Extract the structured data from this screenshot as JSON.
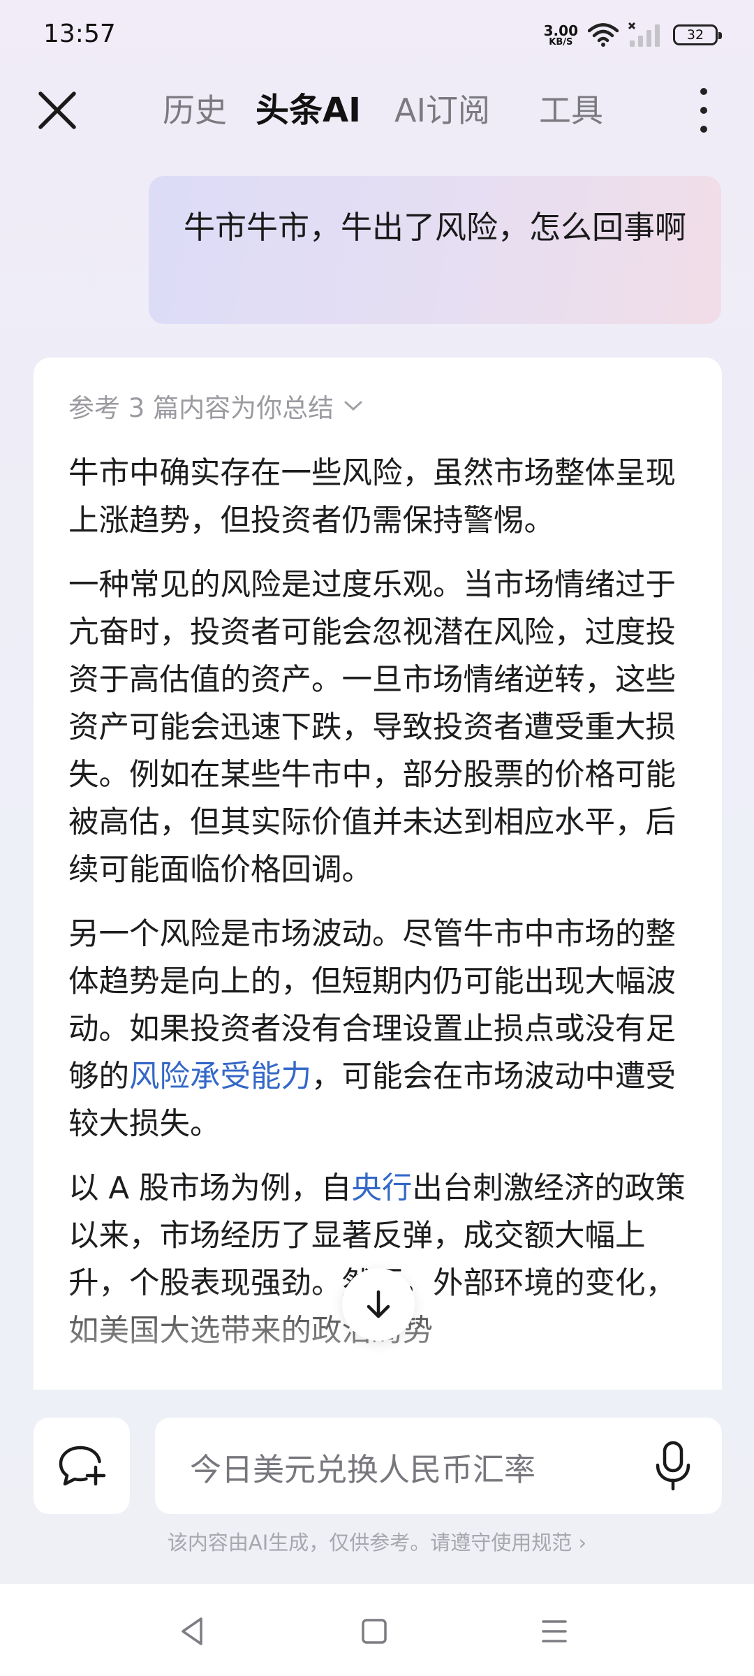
{
  "status_bar": {
    "time": "13:57",
    "net_speed_value": "3.00",
    "net_speed_unit": "KB/S",
    "battery": "32",
    "icons": [
      "wifi-icon",
      "signal-icon",
      "battery-icon"
    ]
  },
  "nav": {
    "tabs": [
      {
        "label": "历史",
        "active": false
      },
      {
        "label": "头条AI",
        "active": true
      },
      {
        "label": "AI订阅",
        "active": false
      },
      {
        "label": "工具",
        "active": false
      }
    ]
  },
  "user_message": "牛市牛市，牛出了风险，怎么回事啊",
  "answer": {
    "ref_summary": "参考 3 篇内容为你总结",
    "p1": "牛市中确实存在一些风险，虽然市场整体呈现上涨趋势，但投资者仍需保持警惕。",
    "p2": "一种常见的风险是过度乐观。当市场情绪过于亢奋时，投资者可能会忽视潜在风险，过度投资于高估值的资产。一旦市场情绪逆转，这些资产可能会迅速下跌，导致投资者遭受重大损失。例如在某些牛市中，部分股票的价格可能被高估，但其实际价值并未达到相应水平，后续可能面临价格回调。",
    "p3_before": "另一个风险是市场波动。尽管牛市中市场的整体趋势是向上的，但短期内仍可能出现大幅波动。如果投资者没有合理设置止损点或没有足够的",
    "p3_link": "风险承受能力",
    "p3_after": "，可能会在市场波动中遭受较大损失。",
    "p4_before": "以 A 股市场为例，自",
    "p4_link": "央行",
    "p4_after": "出台刺激经济的政策以来，市场经历了显著反弹，成交额大幅上升，个股表现强劲。然而，外部环境的变化，如美国大选带来的政治局势"
  },
  "input": {
    "placeholder": "今日美元兑换人民币汇率"
  },
  "disclaimer": "该内容由AI生成，仅供参考。请遵守使用规范 ›",
  "colors": {
    "link": "#3468c8",
    "muted": "#9a9aa0"
  }
}
